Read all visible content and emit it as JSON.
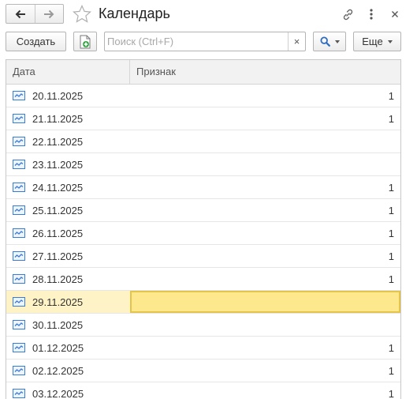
{
  "window": {
    "title": "Календарь",
    "icons": {
      "back": "arrow-left-icon",
      "forward": "arrow-right-icon",
      "favorite": "star-icon",
      "link": "link-icon",
      "more": "more-vertical-icon",
      "close": "close-icon"
    }
  },
  "toolbar": {
    "create_label": "Создать",
    "search": {
      "placeholder": "Поиск (Ctrl+F)",
      "value": "",
      "clear": "×"
    },
    "more_label": "Еще"
  },
  "table": {
    "columns": [
      "Дата",
      "Признак"
    ],
    "rows": [
      {
        "date": "20.11.2025",
        "sign": "1"
      },
      {
        "date": "21.11.2025",
        "sign": "1"
      },
      {
        "date": "22.11.2025",
        "sign": ""
      },
      {
        "date": "23.11.2025",
        "sign": ""
      },
      {
        "date": "24.11.2025",
        "sign": "1"
      },
      {
        "date": "25.11.2025",
        "sign": "1"
      },
      {
        "date": "26.11.2025",
        "sign": "1"
      },
      {
        "date": "27.11.2025",
        "sign": "1"
      },
      {
        "date": "28.11.2025",
        "sign": "1"
      },
      {
        "date": "29.11.2025",
        "sign": "",
        "selected": true
      },
      {
        "date": "30.11.2025",
        "sign": ""
      },
      {
        "date": "01.12.2025",
        "sign": "1"
      },
      {
        "date": "02.12.2025",
        "sign": "1"
      },
      {
        "date": "03.12.2025",
        "sign": "1"
      }
    ]
  },
  "colors": {
    "selection_cell": "#fde88e",
    "selection_row": "#fdf3c6",
    "selection_border": "#e5c44a",
    "row_icon": "#3a7bd5"
  }
}
